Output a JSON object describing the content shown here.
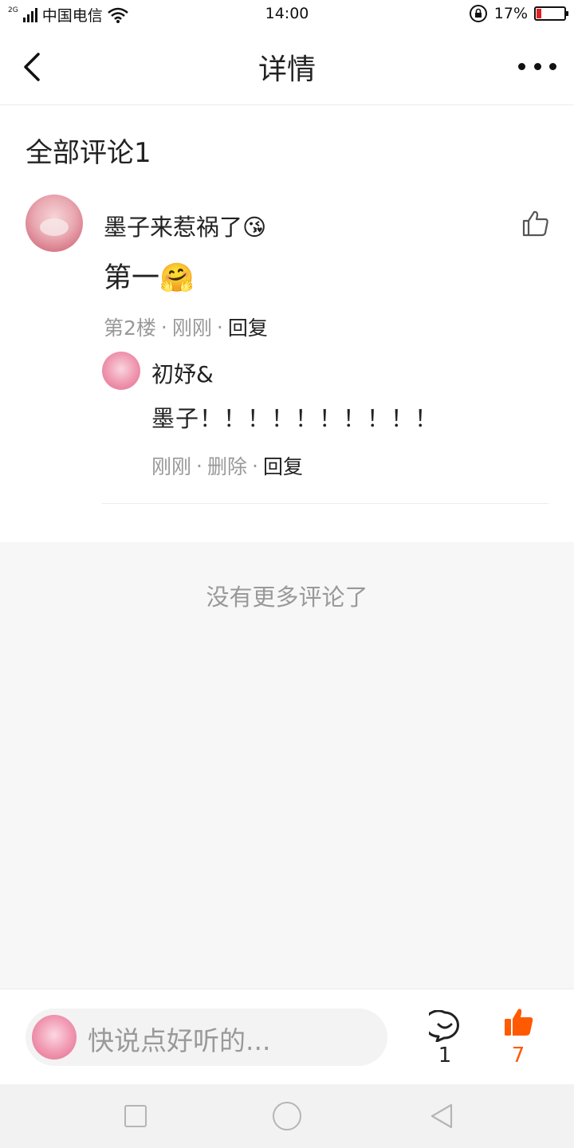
{
  "status_bar": {
    "network": "2G",
    "carrier": "中国电信",
    "time": "14:00",
    "battery_percent": "17%",
    "battery_level": 0.17,
    "battery_color": "#e02020"
  },
  "nav": {
    "title": "详情",
    "back_icon": "chevron-left-icon",
    "more_icon": "more-dots-icon"
  },
  "comments_section": {
    "title": "全部评论1"
  },
  "comment": {
    "author": "墨子来惹祸了😘",
    "text": "第一🤗",
    "floor": "第2楼",
    "time": "刚刚",
    "reply_label": "回复",
    "separator": "·",
    "reply": {
      "author": "初妤&",
      "text": "墨子！！！！！！！！！！",
      "time": "刚刚",
      "delete_label": "删除",
      "reply_label": "回复"
    }
  },
  "footer_note": "没有更多评论了",
  "bottom_bar": {
    "input_placeholder": "快说点好听的...",
    "comment_count": "1",
    "like_count": "7",
    "accent_color": "#ff5a00"
  },
  "system_nav": {
    "recent_icon": "square-icon",
    "home_icon": "circle-icon",
    "back_icon": "triangle-back-icon"
  }
}
